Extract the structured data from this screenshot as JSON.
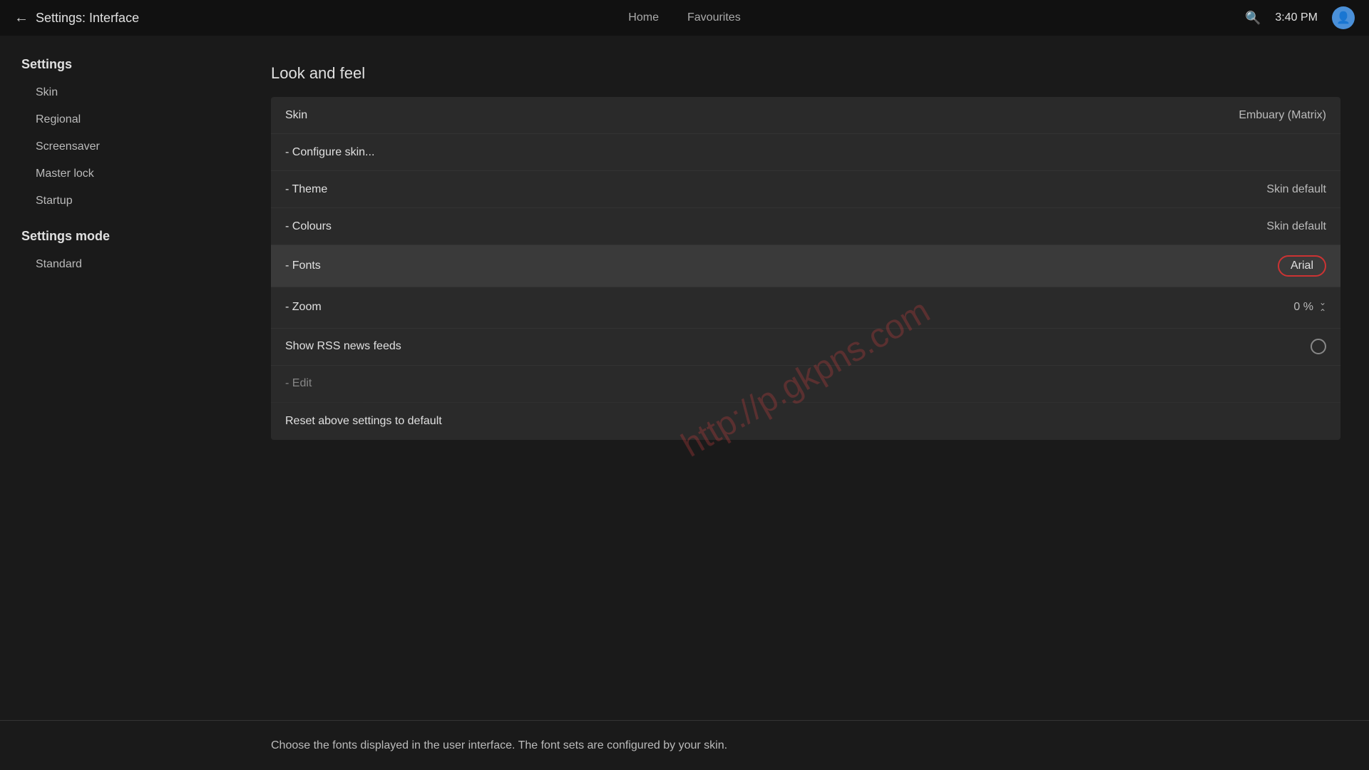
{
  "header": {
    "back_icon": "←",
    "title": "Settings: Interface",
    "nav": [
      {
        "label": "Home"
      },
      {
        "label": "Favourites"
      }
    ],
    "search_icon": "🔍",
    "time": "3:40 PM",
    "avatar_icon": "👤"
  },
  "sidebar": {
    "section1_label": "Settings",
    "items": [
      {
        "label": "Skin"
      },
      {
        "label": "Regional"
      },
      {
        "label": "Screensaver"
      },
      {
        "label": "Master lock"
      },
      {
        "label": "Startup"
      }
    ],
    "section2_label": "Settings mode",
    "items2": [
      {
        "label": "Standard"
      }
    ]
  },
  "main": {
    "section_title": "Look and feel",
    "rows": [
      {
        "label": "Skin",
        "value": "Embuary (Matrix)",
        "type": "normal",
        "highlighted": false
      },
      {
        "label": "- Configure skin...",
        "value": "",
        "type": "normal",
        "highlighted": false
      },
      {
        "label": "- Theme",
        "value": "Skin default",
        "type": "normal",
        "highlighted": false
      },
      {
        "label": "- Colours",
        "value": "Skin default",
        "type": "normal",
        "highlighted": false
      },
      {
        "label": "- Fonts",
        "value": "Arial",
        "type": "circled",
        "highlighted": true
      },
      {
        "label": "- Zoom",
        "value": "0 %",
        "type": "zoom",
        "highlighted": false
      },
      {
        "label": "Show RSS news feeds",
        "value": "",
        "type": "toggle",
        "highlighted": false
      },
      {
        "label": "- Edit",
        "value": "",
        "type": "normal",
        "highlighted": false,
        "disabled": true
      },
      {
        "label": "Reset above settings to default",
        "value": "",
        "type": "normal",
        "highlighted": false
      }
    ]
  },
  "bottom": {
    "text": "Choose the fonts displayed in the user interface. The font sets are configured by your skin."
  },
  "watermark": {
    "line1": "http://p.gkpns.com"
  }
}
